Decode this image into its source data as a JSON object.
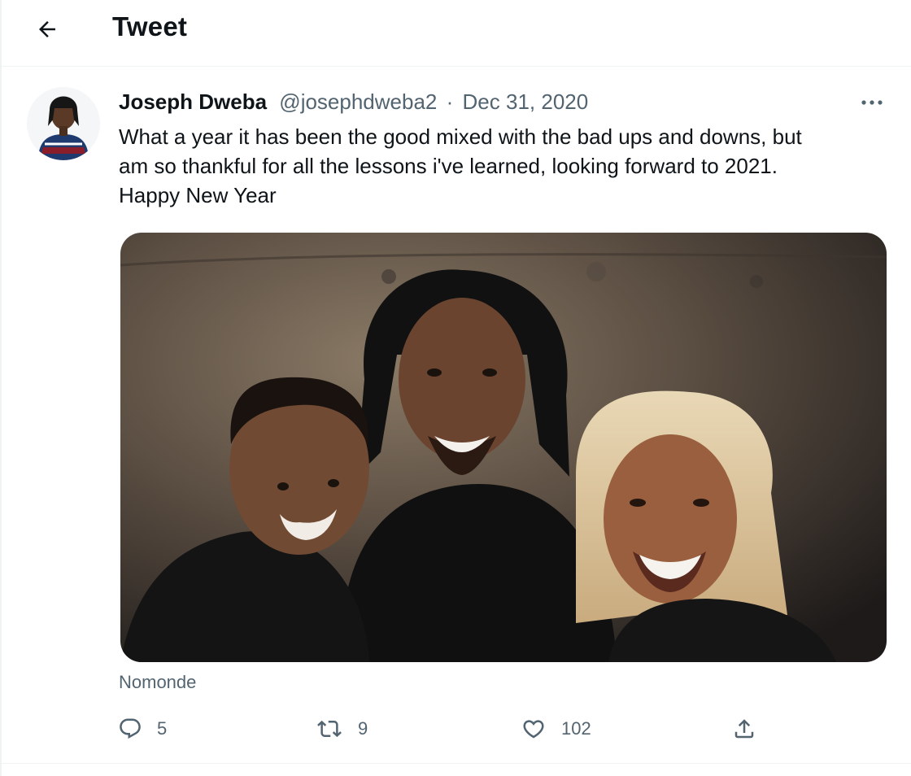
{
  "header": {
    "title": "Tweet",
    "back_icon": "arrow-left-icon"
  },
  "tweet": {
    "author_name": "Joseph Dweba",
    "author_handle": "@josephdweba2",
    "separator": "·",
    "date": "Dec 31, 2020",
    "text_lines": [
      "What a year it has been the good mixed with the bad ups and downs, but",
      "am so thankful for all the lessons i've learned, looking forward to 2021.",
      "Happy New Year"
    ],
    "media_tag": "Nomonde",
    "more_icon": "more-horizontal-icon"
  },
  "actions": {
    "reply_count": "5",
    "retweet_count": "9",
    "like_count": "102",
    "icons": [
      "reply-icon",
      "retweet-icon",
      "like-icon",
      "share-icon"
    ]
  },
  "colors": {
    "text_primary": "#0f1419",
    "text_secondary": "#536471",
    "divider": "#eff3f4"
  }
}
